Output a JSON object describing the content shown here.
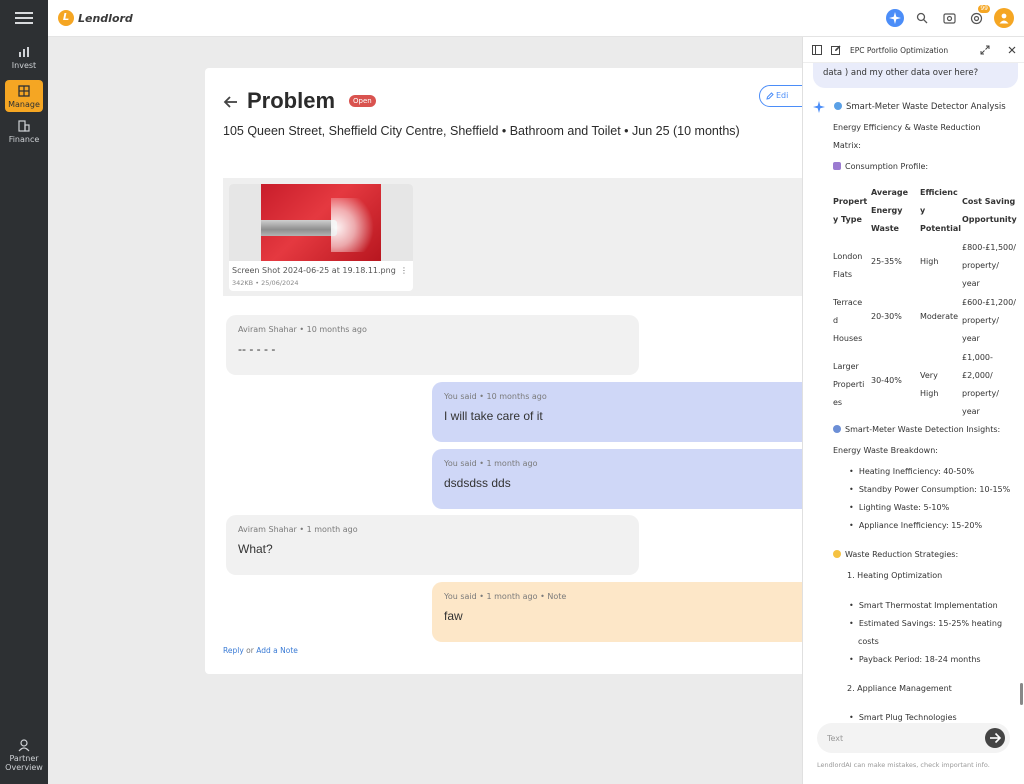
{
  "app": {
    "brand": "Lendlord",
    "logo_letter": "L"
  },
  "leftnav": {
    "items": [
      {
        "label": "Invest",
        "icon": "invest-icon"
      },
      {
        "label": "Manage",
        "icon": "manage-icon",
        "active": true
      },
      {
        "label": "Finance",
        "icon": "finance-icon"
      }
    ],
    "bottom": {
      "line1": "Partner",
      "line2": "Overview",
      "icon": "partner-icon"
    }
  },
  "topbar": {
    "notification_count": "99"
  },
  "problem": {
    "title": "Problem",
    "status": "Open",
    "edit_label": "Edi",
    "subtitle": "105 Queen Street, Sheffield City Centre, Sheffield • Bathroom and Toilet • Jun 25 (10 months)",
    "attachment": {
      "filename": "Screen Shot 2024-06-25 at 19.18.11.png",
      "meta": "342KB • 25/06/2024"
    }
  },
  "messages": [
    {
      "type": "other",
      "meta": "Aviram Shahar • 10 months ago",
      "body": "-- - - - -"
    },
    {
      "type": "mine",
      "meta": "You said • 10 months ago",
      "body": "I will take care of it"
    },
    {
      "type": "mine",
      "meta": "You said • 1 month ago",
      "body": "dsdsdss dds"
    },
    {
      "type": "other",
      "meta": "Aviram Shahar • 1 month ago",
      "body": "What?"
    },
    {
      "type": "note",
      "meta": "You said • 1 month ago • Note",
      "body": "faw"
    }
  ],
  "reply": {
    "reply_label": "Reply",
    "or": "or",
    "note_label": "Add a Note"
  },
  "panel": {
    "title": "EPC Portfolio Optimization",
    "user_tail": "data ) and my other data over here?",
    "heading": "Smart-Meter Waste Detector Analysis",
    "matrix_title_1": "Energy Efficiency & Waste Reduction",
    "matrix_title_2": "Matrix:",
    "consumption_profile": "Consumption Profile:",
    "table": {
      "headers": [
        [
          "Propert",
          "y Type"
        ],
        [
          "Average",
          "Energy",
          "Waste"
        ],
        [
          "Efficienc",
          "y",
          "Potential"
        ],
        [
          "Cost Saving",
          "Opportunity"
        ]
      ],
      "rows": [
        {
          "type": [
            "London",
            "Flats"
          ],
          "waste": "25-35%",
          "potential": [
            "High"
          ],
          "saving": [
            "£800-£1,500/",
            "property/",
            "year"
          ]
        },
        {
          "type": [
            "Terrace",
            "d",
            "Houses"
          ],
          "waste": "20-30%",
          "potential": [
            "Moderate"
          ],
          "saving": [
            "£600-£1,200/",
            "property/",
            "year"
          ]
        },
        {
          "type": [
            "Larger",
            "Properti",
            "es"
          ],
          "waste": "30-40%",
          "potential": [
            "Very",
            "High"
          ],
          "saving": [
            "£1,000-",
            "£2,000/",
            "property/",
            "year"
          ]
        }
      ]
    },
    "insights_heading": "Smart-Meter Waste Detection Insights:",
    "breakdown_heading": "Energy Waste Breakdown:",
    "breakdown": [
      "Heating Inefficiency: 40-50%",
      "Standby Power Consumption: 10-15%",
      "Lighting Waste: 5-10%",
      "Appliance Inefficiency: 15-20%"
    ],
    "strategies_heading": "Waste Reduction Strategies:",
    "strategy1": "1. Heating Optimization",
    "strategy1_items": [
      "Smart Thermostat Implementation",
      "Estimated Savings: 15-25% heating",
      "costs",
      "Payback Period: 18-24 months"
    ],
    "strategy2": "2. Appliance Management",
    "strategy2_items": [
      "Smart Plug Technologies"
    ],
    "input_placeholder": "Text",
    "disclaimer": "LendlordAI can make mistakes, check important info."
  },
  "colors": {
    "accent": "#f5a623",
    "primary": "#4b8df8",
    "status_open": "#d9534f",
    "mine_bubble": "#cfd7f7",
    "note_bubble": "#fde7c8"
  }
}
